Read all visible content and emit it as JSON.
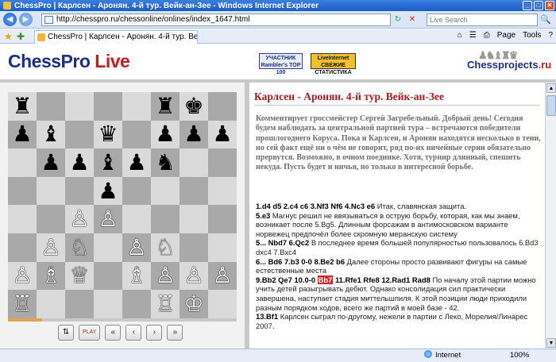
{
  "window": {
    "title": "ChessPro | Карлсен - Аронян. 4-й тур. Вейк-ан-Зее - Windows Internet Explorer",
    "min": "_",
    "max": "□",
    "close": "✕"
  },
  "address": {
    "url": "http://chesspro.ru/chessonline/onlines/index_1647.html",
    "search_placeholder": "Live Search",
    "back": "◀",
    "forward": "▶",
    "go_icon": "↻",
    "stop_icon": "✕",
    "search_icon": "🔍"
  },
  "tabs": [
    {
      "label": "ChessPro | Карлсен - Аронян. 4-й тур. Вейк-ан-Зее"
    }
  ],
  "toolbar": {
    "home": "⌂",
    "feeds": "☰",
    "print": "⎙",
    "page": "Page",
    "tools": "Tools",
    "help": "?"
  },
  "header": {
    "logo_main": "ChessPro",
    "logo_live": "Live",
    "badge1_line1": "УЧАСТНИК",
    "badge1_line2": "Rambler's TOP 100",
    "badge2_line1": "LiveInternet",
    "badge2_line2": "СВЕЖИЕ СТАТИСТИКА",
    "cp_logo_main": "Chesspro",
    "cp_logo_sub": "jects",
    "cp_logo_dot": ".ru"
  },
  "board": {
    "rows": [
      [
        {
          "p": "♜",
          "c": "b"
        },
        {
          "p": "",
          "c": ""
        },
        {
          "p": "",
          "c": ""
        },
        {
          "p": "",
          "c": ""
        },
        {
          "p": "",
          "c": ""
        },
        {
          "p": "♜",
          "c": "b"
        },
        {
          "p": "♚",
          "c": "b"
        },
        {
          "p": "",
          "c": ""
        }
      ],
      [
        {
          "p": "♟",
          "c": "b"
        },
        {
          "p": "♝",
          "c": "b"
        },
        {
          "p": "",
          "c": ""
        },
        {
          "p": "♛",
          "c": "b"
        },
        {
          "p": "",
          "c": ""
        },
        {
          "p": "♟",
          "c": "b"
        },
        {
          "p": "♟",
          "c": "b"
        },
        {
          "p": "♟",
          "c": "b"
        }
      ],
      [
        {
          "p": "",
          "c": ""
        },
        {
          "p": "♟",
          "c": "b"
        },
        {
          "p": "♟",
          "c": "b"
        },
        {
          "p": "♝",
          "c": "b"
        },
        {
          "p": "♟",
          "c": "b"
        },
        {
          "p": "♞",
          "c": "b"
        },
        {
          "p": "",
          "c": ""
        },
        {
          "p": "",
          "c": ""
        }
      ],
      [
        {
          "p": "",
          "c": ""
        },
        {
          "p": "",
          "c": ""
        },
        {
          "p": "",
          "c": ""
        },
        {
          "p": "♟",
          "c": "b"
        },
        {
          "p": "",
          "c": ""
        },
        {
          "p": "",
          "c": ""
        },
        {
          "p": "",
          "c": ""
        },
        {
          "p": "",
          "c": ""
        }
      ],
      [
        {
          "p": "",
          "c": ""
        },
        {
          "p": "",
          "c": ""
        },
        {
          "p": "♙",
          "c": "w"
        },
        {
          "p": "♙",
          "c": "w"
        },
        {
          "p": "",
          "c": ""
        },
        {
          "p": "",
          "c": ""
        },
        {
          "p": "",
          "c": ""
        },
        {
          "p": "",
          "c": ""
        }
      ],
      [
        {
          "p": "",
          "c": ""
        },
        {
          "p": "♙",
          "c": "w"
        },
        {
          "p": "♘",
          "c": "w"
        },
        {
          "p": "",
          "c": ""
        },
        {
          "p": "♙",
          "c": "w"
        },
        {
          "p": "♘",
          "c": "w"
        },
        {
          "p": "",
          "c": ""
        },
        {
          "p": "",
          "c": ""
        }
      ],
      [
        {
          "p": "♙",
          "c": "w"
        },
        {
          "p": "♗",
          "c": "w"
        },
        {
          "p": "♕",
          "c": "w"
        },
        {
          "p": "",
          "c": ""
        },
        {
          "p": "♗",
          "c": "w"
        },
        {
          "p": "♙",
          "c": "w"
        },
        {
          "p": "♙",
          "c": "w"
        },
        {
          "p": "♙",
          "c": "w"
        }
      ],
      [
        {
          "p": "♖",
          "c": "w"
        },
        {
          "p": "",
          "c": ""
        },
        {
          "p": "",
          "c": ""
        },
        {
          "p": "",
          "c": ""
        },
        {
          "p": "",
          "c": ""
        },
        {
          "p": "♖",
          "c": "w"
        },
        {
          "p": "♔",
          "c": "w"
        },
        {
          "p": "",
          "c": ""
        }
      ]
    ],
    "progress": 0.15
  },
  "controls": {
    "flip": "⇅",
    "play": "PLAY",
    "first": "«",
    "prev": "‹",
    "next": "›",
    "last": "»"
  },
  "article": {
    "title": "Карлсен - Аронян. 4-й тур. Вейк-ан-Зее",
    "intro": "Комментирует гроссмейстер Сергей Загребельный. Добрый день! Сегодня будем наблюдать за центральной партией тура – встречаются победители прошлогоднего Коруса. Пока и Карлсен, и Аронян находятся несколько в тени, но сей факт ещё ни о чём не говорит, ряд по-их ничейные серии обязательно прервутся. Возможно, в очном поединке. Хотя, турнир длинный, спешить некуда. Пусть будет и ничья, но только в интересной борьбе.",
    "p1_moves": "1.d4 d5 2.c4 c6 3.Nf3 Nf6 4.Nc3 e6",
    "p1_text": " Итак, славянская защита.",
    "p2_moves": "5.e3",
    "p2_text": " Магнус решил не ввязываться в острую борьбу, которая, как мы знаем, возникает после 5.Bg5. Длинным форсажам в антимосковском варианте норвежец предпочёл более скромную меранскую систему",
    "p3_moves": "5... Nbd7 6.Qc2",
    "p3_text": " В последнее время большей популярностью пользовалось 6.Bd3 dxc4 7.Bxc4",
    "p4_moves": "6... Bd6 7.b3 0-0 8.Be2 b6",
    "p4_text": " Далее стороны просто развивают фигуры на самые естественные места",
    "p5_moves": "9.Bb2 Qe7 10.0-0",
    "p5_current": "Bb7",
    "p5_moves2": " 11.Rfe1 Rfe8 12.Rad1 Rad8",
    "p5_text": " По началу этой партии можно учить детей разыгрывать дебют. Однако консолидация сил практически завершена, наступает стадия миттельшпиля. К этой позиции люди приходили разным порядком ходов, всего же партий в моей базе - 42.",
    "p6_moves": "13.Bf1",
    "p6_text": " Карлсен сыграл по-другому, нежели в партии с Леко, Морелия/Линарес 2007."
  },
  "status": {
    "zone": "Internet",
    "zoom": "100%"
  }
}
